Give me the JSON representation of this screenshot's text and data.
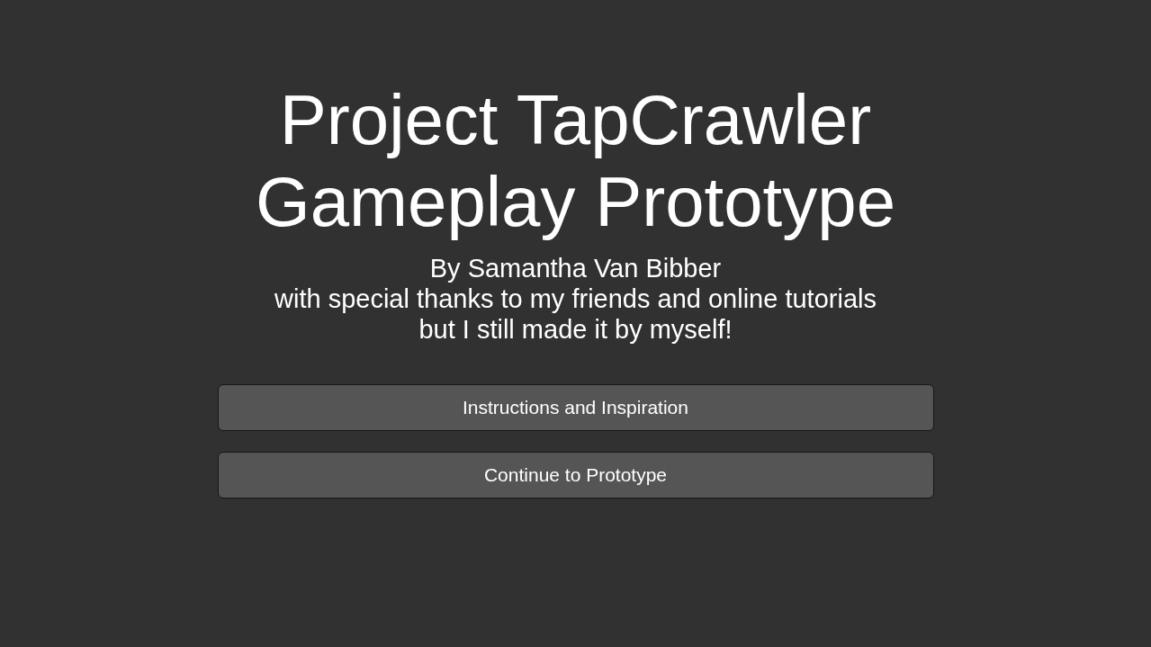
{
  "title_lines": [
    "Project TapCrawler",
    "Gameplay Prototype"
  ],
  "credits": [
    "By Samantha Van Bibber",
    "with special thanks to my friends and online tutorials",
    "but I still made it by myself!"
  ],
  "buttons": [
    "Instructions and Inspiration",
    "Continue to Prototype"
  ]
}
